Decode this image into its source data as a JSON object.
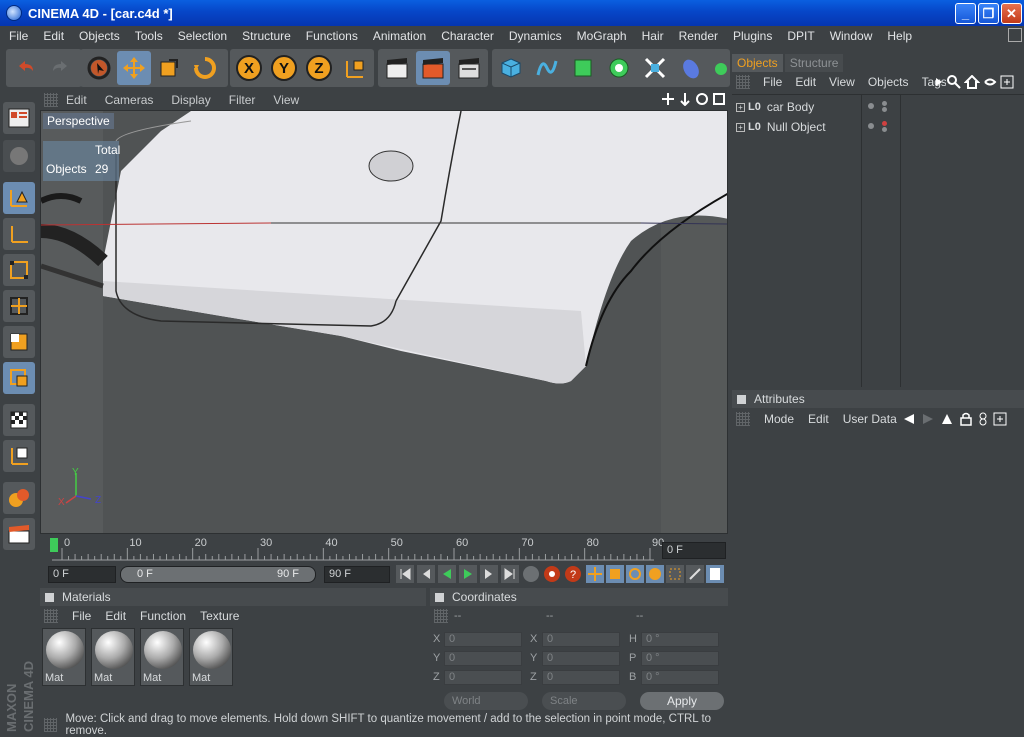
{
  "window": {
    "title": "CINEMA 4D - [car.c4d *]",
    "minimize": "_",
    "maximize": "❐",
    "close": "✕"
  },
  "menu": [
    "File",
    "Edit",
    "Objects",
    "Tools",
    "Selection",
    "Structure",
    "Functions",
    "Animation",
    "Character",
    "Dynamics",
    "MoGraph",
    "Hair",
    "Render",
    "Plugins",
    "DPIT",
    "Window",
    "Help"
  ],
  "toolbar": {
    "x_label": "X",
    "y_label": "Y",
    "z_label": "Z"
  },
  "viewport": {
    "menu": [
      "Edit",
      "Cameras",
      "Display",
      "Filter",
      "View"
    ],
    "camera_label": "Perspective",
    "hud_header": "Total",
    "hud_objects_label": "Objects",
    "hud_objects_value": "29",
    "axis_x": "X",
    "axis_y": "Y",
    "axis_z": "Z"
  },
  "timeline": {
    "ticks": [
      "0",
      "10",
      "20",
      "30",
      "40",
      "50",
      "60",
      "70",
      "80",
      "90"
    ],
    "current_frame": "0 F",
    "start_field": "0 F",
    "range_start": "0 F",
    "range_end": "90 F",
    "end_field": "90 F"
  },
  "materials": {
    "title": "Materials",
    "menu": [
      "File",
      "Edit",
      "Function",
      "Texture"
    ],
    "items": [
      "Mat",
      "Mat",
      "Mat",
      "Mat"
    ]
  },
  "coordinates": {
    "title": "Coordinates",
    "col_headers": [
      "--",
      "--",
      "--"
    ],
    "rows": [
      {
        "l1": "X",
        "v1": "0",
        "l2": "X",
        "v2": "0",
        "l3": "H",
        "v3": "0 °"
      },
      {
        "l1": "Y",
        "v1": "0",
        "l2": "Y",
        "v2": "0",
        "l3": "P",
        "v3": "0 °"
      },
      {
        "l1": "Z",
        "v1": "0",
        "l2": "Z",
        "v2": "0",
        "l3": "B",
        "v3": "0 °"
      }
    ],
    "world": "World",
    "scale": "Scale",
    "apply": "Apply"
  },
  "status": "Move: Click and drag to move elements. Hold down SHIFT to quantize movement / add to the selection in point mode, CTRL to remove.",
  "objects_panel": {
    "tabs": [
      "Objects",
      "Structure"
    ],
    "menu": [
      "File",
      "Edit",
      "View",
      "Objects",
      "Tags"
    ],
    "items": [
      {
        "name": "car Body"
      },
      {
        "name": "Null Object"
      }
    ]
  },
  "attributes_panel": {
    "title": "Attributes",
    "menu": [
      "Mode",
      "Edit",
      "User Data"
    ]
  },
  "brand": {
    "line1": "MAXON",
    "line2": "CINEMA 4D"
  }
}
